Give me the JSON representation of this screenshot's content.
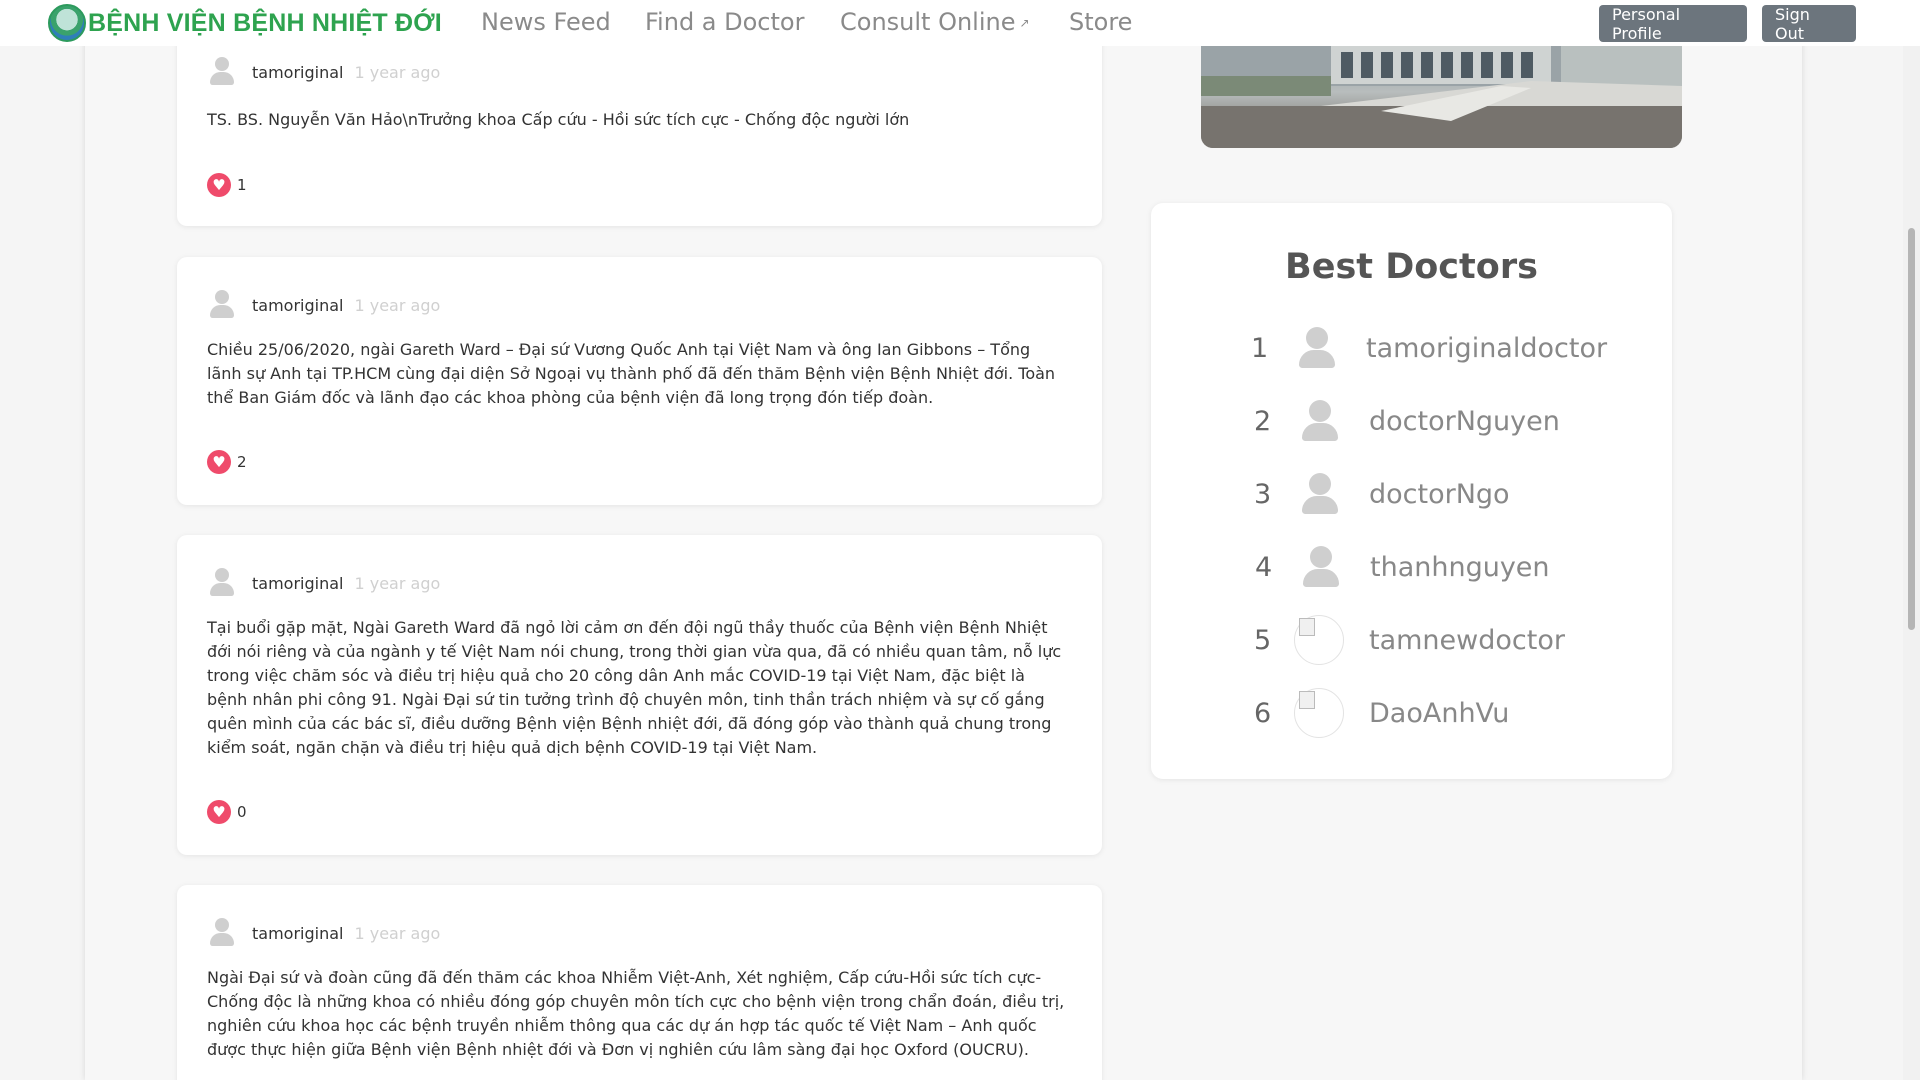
{
  "navbar": {
    "brand": "BỆNH VIỆN BỆNH NHIỆT ĐỚI",
    "links": {
      "news_feed": "News Feed",
      "find_doctor": "Find a Doctor",
      "consult_online": "Consult Online",
      "store": "Store"
    },
    "buttons": {
      "personal_profile": "Personal Profile",
      "sign_out": "Sign Out"
    }
  },
  "posts": [
    {
      "author": "tamoriginal",
      "time": "1 year ago",
      "body": "TS. BS. Nguyễn Văn Hảo\\nTrưởng khoa Cấp cứu - Hồi sức tích cực - Chống độc người lớn",
      "likes": "1"
    },
    {
      "author": "tamoriginal",
      "time": "1 year ago",
      "body": "Chiều 25/06/2020, ngài Gareth Ward – Đại sứ Vương Quốc Anh tại Việt Nam và ông Ian Gibbons – Tổng lãnh sự Anh tại TP.HCM cùng đại diện Sở Ngoại vụ thành phố đã đến thăm Bệnh viện Bệnh Nhiệt đới. Toàn thể Ban Giám đốc và lãnh đạo các khoa phòng của bệnh viện đã long trọng đón tiếp đoàn.",
      "likes": "2"
    },
    {
      "author": "tamoriginal",
      "time": "1 year ago",
      "body": "Tại buổi gặp mặt, Ngài Gareth Ward đã ngỏ lời cảm ơn đến đội ngũ thầy thuốc của Bệnh viện Bệnh Nhiệt đới nói riêng và của ngành y tế Việt Nam nói chung, trong thời gian vừa qua, đã có nhiều quan tâm, nỗ lực trong việc chăm sóc và điều trị hiệu quả cho 20 công dân Anh mắc COVID-19 tại Việt Nam, đặc biệt là bệnh nhân phi công 91. Ngài Đại sứ tin tưởng trình độ chuyên môn, tinh thần trách nhiệm và sự cố gắng quên mình của các bác sĩ, điều dưỡng Bệnh viện Bệnh nhiệt đới, đã đóng góp vào thành quả chung trong kiểm soát, ngăn chặn và điều trị hiệu quả dịch bệnh COVID-19 tại Việt Nam.",
      "likes": "0"
    },
    {
      "author": "tamoriginal",
      "time": "1 year ago",
      "body": "Ngài Đại sứ và đoàn cũng đã đến thăm các khoa Nhiễm Việt-Anh, Xét nghiệm, Cấp cứu-Hồi sức tích cực-Chống độc là những khoa có nhiều đóng góp chuyên môn tích cực cho bệnh viện trong chẩn đoán, điều trị, nghiên cứu khoa học các bệnh truyền nhiễm thông qua các dự án hợp tác quốc tế Việt Nam – Anh quốc được thực hiện giữa Bệnh viện Bệnh nhiệt đới và Đơn vị nghiên cứu lâm sàng đại học Oxford (OUCRU).",
      "likes": ""
    }
  ],
  "best_doctors": {
    "title": "Best Doctors",
    "items": [
      {
        "rank": "1",
        "name": "tamoriginaldoctor",
        "avatar": "generic"
      },
      {
        "rank": "2",
        "name": "doctorNguyen",
        "avatar": "generic"
      },
      {
        "rank": "3",
        "name": "doctorNgo",
        "avatar": "generic"
      },
      {
        "rank": "4",
        "name": "thanhnguyen",
        "avatar": "generic"
      },
      {
        "rank": "5",
        "name": "tamnewdoctor",
        "avatar": "broken"
      },
      {
        "rank": "6",
        "name": "DaoAnhVu",
        "avatar": "broken"
      }
    ]
  },
  "icons": {
    "like": "heart-icon",
    "external": "external-link-icon",
    "user": "user-avatar-icon"
  },
  "colors": {
    "brand": "#2ea34f",
    "button": "#6c757d",
    "heart": "#ef4b6b"
  }
}
